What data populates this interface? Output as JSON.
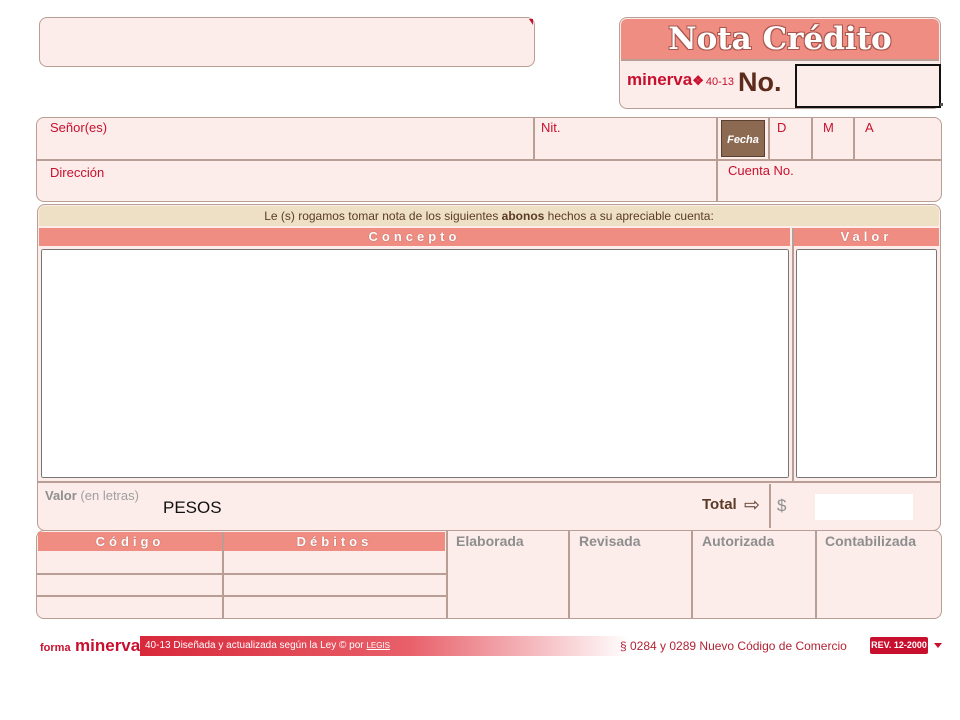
{
  "header": {
    "title": "Nota Crédito",
    "brand": "minerva",
    "form_code": "40-13",
    "number_label": "No."
  },
  "client": {
    "senores_label": "Señor(es)",
    "nit_label": "Nit.",
    "fecha_label": "Fecha",
    "day_label": "D",
    "month_label": "M",
    "year_label": "A",
    "direccion_label": "Dirección",
    "cuenta_label": "Cuenta No."
  },
  "notice": {
    "before": "Le (s) rogamos tomar nota de los siguientes ",
    "bold": "abonos",
    "after": " hechos a su apreciable cuenta:"
  },
  "table": {
    "concepto_header": "Concepto",
    "valor_header": "Valor"
  },
  "amount": {
    "valor_label": "Valor",
    "en_letras_label": "(en letras)",
    "pesos_text": "PESOS",
    "total_label": "Total",
    "currency_symbol": "$"
  },
  "bottom": {
    "codigo_header": "Código",
    "debitos_header": "Débitos",
    "elaborada": "Elaborada",
    "revisada": "Revisada",
    "autorizada": "Autorizada",
    "contabilizada": "Contabilizada"
  },
  "footer": {
    "forma": "forma",
    "brand": "minerva",
    "left_text": "40-13 Diseñada y actualizada según la Ley © por",
    "legis": "LEGIS",
    "right_text": "§ 0284 y 0289 Nuevo Código de Comercio",
    "rev": "REV. 12-2000"
  },
  "colors": {
    "accent": "#c8102e",
    "header_salmon": "#ef8d83",
    "panel_pink": "#fcecea",
    "border": "#b89e94"
  }
}
